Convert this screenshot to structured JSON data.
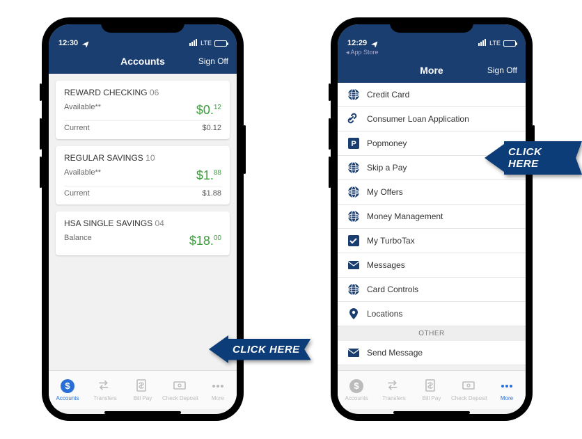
{
  "callout": "CLICK HERE",
  "phone1": {
    "status_time": "12:30",
    "signal_label": "LTE",
    "header_title": "Accounts",
    "sign_off": "Sign Off",
    "accounts": [
      {
        "name": "REWARD CHECKING",
        "num": "06",
        "rows": [
          {
            "label": "Available**",
            "amt_main": "$0.",
            "amt_cents": "12",
            "big": true
          },
          {
            "label": "Current",
            "amt": "$0.12",
            "big": false
          }
        ]
      },
      {
        "name": "REGULAR SAVINGS",
        "num": "10",
        "rows": [
          {
            "label": "Available**",
            "amt_main": "$1.",
            "amt_cents": "88",
            "big": true
          },
          {
            "label": "Current",
            "amt": "$1.88",
            "big": false
          }
        ]
      },
      {
        "name": "HSA SINGLE SAVINGS",
        "num": "04",
        "rows": [
          {
            "label": "Balance",
            "amt_main": "$18.",
            "amt_cents": "00",
            "big": true
          }
        ]
      }
    ],
    "tabs": [
      {
        "label": "Accounts",
        "icon": "dollar-circle",
        "active": true
      },
      {
        "label": "Transfers",
        "icon": "transfer"
      },
      {
        "label": "Bill Pay",
        "icon": "billpay"
      },
      {
        "label": "Check Deposit",
        "icon": "check"
      },
      {
        "label": "More",
        "icon": "dots"
      }
    ]
  },
  "phone2": {
    "status_time": "12:29",
    "back_app": "◂ App Store",
    "signal_label": "LTE",
    "header_title": "More",
    "sign_off": "Sign Off",
    "items": [
      {
        "label": "Credit Card",
        "icon": "globe"
      },
      {
        "label": "Consumer Loan Application",
        "icon": "link"
      },
      {
        "label": "Popmoney",
        "icon": "p-square"
      },
      {
        "label": "Skip a Pay",
        "icon": "globe"
      },
      {
        "label": "My Offers",
        "icon": "globe"
      },
      {
        "label": "Money Management",
        "icon": "globe"
      },
      {
        "label": "My TurboTax",
        "icon": "check-square"
      },
      {
        "label": "Messages",
        "icon": "envelope"
      },
      {
        "label": "Card Controls",
        "icon": "globe"
      },
      {
        "label": "Locations",
        "icon": "pin"
      }
    ],
    "section_other": "OTHER",
    "other_items": [
      {
        "label": "Send Message",
        "icon": "envelope"
      }
    ],
    "tabs": [
      {
        "label": "Accounts",
        "icon": "dollar-circle"
      },
      {
        "label": "Transfers",
        "icon": "transfer"
      },
      {
        "label": "Bill Pay",
        "icon": "billpay"
      },
      {
        "label": "Check Deposit",
        "icon": "check"
      },
      {
        "label": "More",
        "icon": "dots",
        "active": true
      }
    ]
  }
}
